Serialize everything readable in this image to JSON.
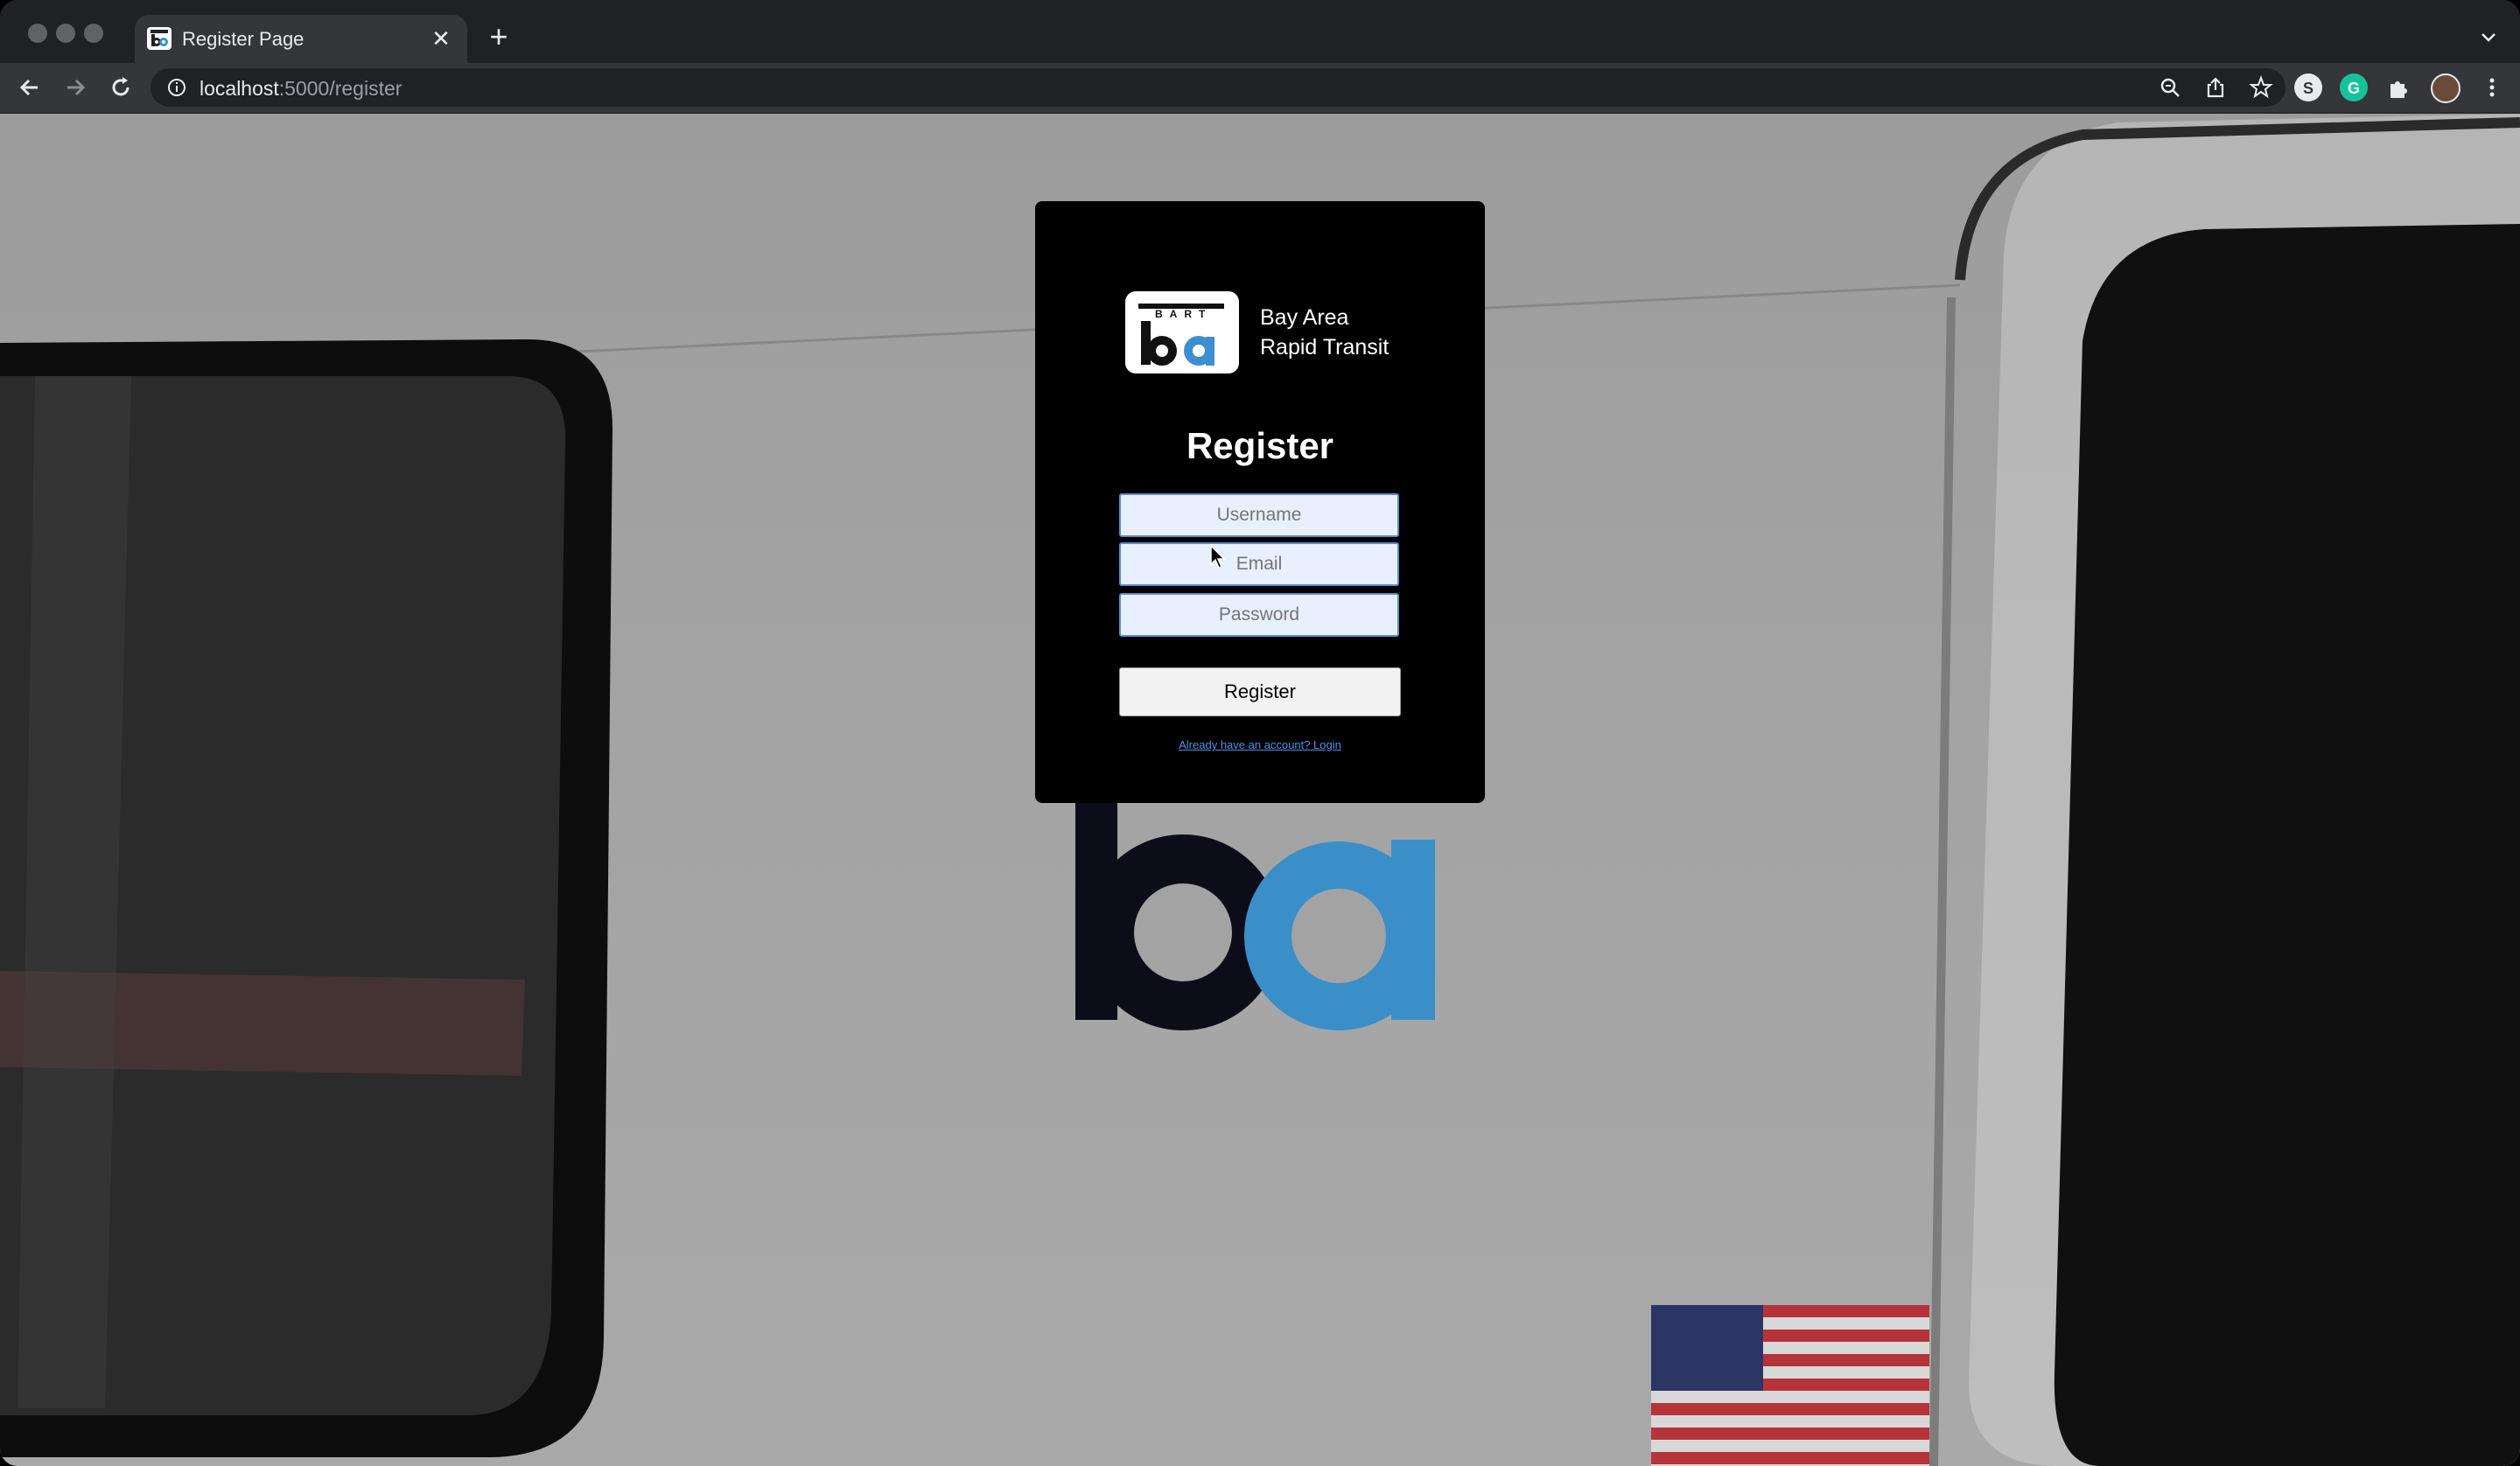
{
  "browser": {
    "tab": {
      "title": "Register Page"
    },
    "url": {
      "host": "localhost",
      "path": ":5000/register"
    }
  },
  "form": {
    "logo_line1": "Bay Area",
    "logo_line2": "Rapid Transit",
    "logo_mark_top": "BART",
    "title": "Register",
    "username_placeholder": "Username",
    "email_placeholder": "Email",
    "password_placeholder": "Password",
    "submit_label": "Register",
    "login_link": "Already have an account? Login"
  },
  "colors": {
    "card_bg": "#000000",
    "input_bg": "#e8f0fe",
    "input_border": "#5b8ccd",
    "link": "#4f8fe6",
    "bart_blue": "#3d8fd0"
  },
  "icons": {
    "back": "back-arrow-icon",
    "forward": "forward-arrow-icon",
    "reload": "reload-icon",
    "site_info": "info-icon",
    "zoom": "zoom-icon",
    "share": "share-icon",
    "bookmark": "star-icon",
    "extensions": "puzzle-icon",
    "menu": "kebab-menu-icon"
  }
}
